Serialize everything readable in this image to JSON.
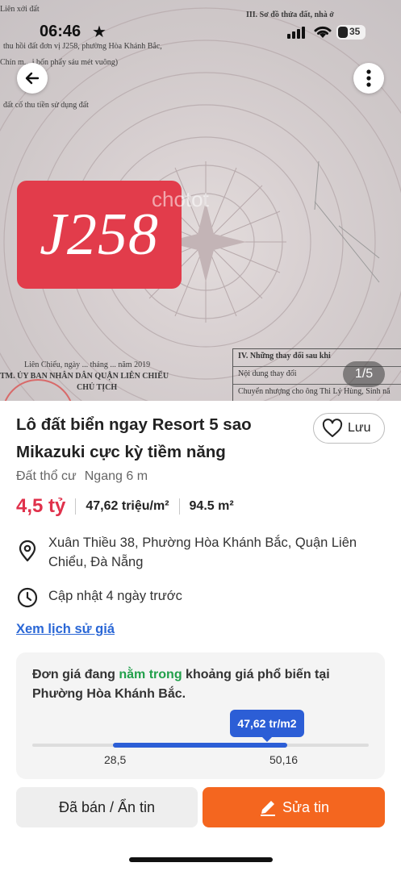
{
  "status_bar": {
    "time": "06:46",
    "battery": "35"
  },
  "image": {
    "counter": "1/5",
    "badge_text": "J258",
    "watermark": "chotot",
    "document_lines": [
      "Liên xới đất",
      "thu hồi đất đơn vị J258, phường Hòa Khánh Bắc,",
      "Chín m... i bốn phẩy sáu mét vuông)",
      "đất cố thu tiền sử dụng đất",
      "Liên Chiểu, ngày ... tháng ... năm 2019",
      "TM. ỦY BAN NHÂN DÂN QUẬN LIÊN CHIỂU",
      "CHỦ TỊCH",
      "III. Sơ đồ thửa đất, nhà ở",
      "IV. Những thay đổi sau khi",
      "Nội dung thay đổi",
      "Chuyển nhượng cho ông Thi Lý Hùng, Sinh nă"
    ]
  },
  "listing": {
    "title": "Lô đất biển ngay Resort 5 sao Mikazuki cực kỳ tiềm năng",
    "save_label": "Lưu",
    "land_type": "Đất thổ cư",
    "width": "Ngang 6 m",
    "price": "4,5 tỷ",
    "price_per_m2": "47,62 triệu/m²",
    "area": "94.5 m²",
    "address": "Xuân Thiều 38, Phường Hòa Khánh Bắc, Quận Liên Chiểu, Đà Nẵng",
    "updated": "Cập nhật 4 ngày trước",
    "history_link": "Xem lịch sử giá"
  },
  "price_range": {
    "text_before": "Đơn giá đang ",
    "highlight": "nằm trong",
    "text_after": " khoảng giá phổ biến tại Phường Hòa Khánh Bắc.",
    "current_label": "47,62 tr/m2",
    "min_label": "28,5",
    "max_label": "50,16",
    "range_min": 28.5,
    "range_max": 50.16,
    "current_value": 47.62,
    "highlight_color": "#22a04b",
    "bar_color": "#2c5ed6"
  },
  "actions": {
    "hide_label": "Đã bán / Ẩn tin",
    "edit_label": "Sửa tin",
    "edit_color": "#f4661f"
  }
}
